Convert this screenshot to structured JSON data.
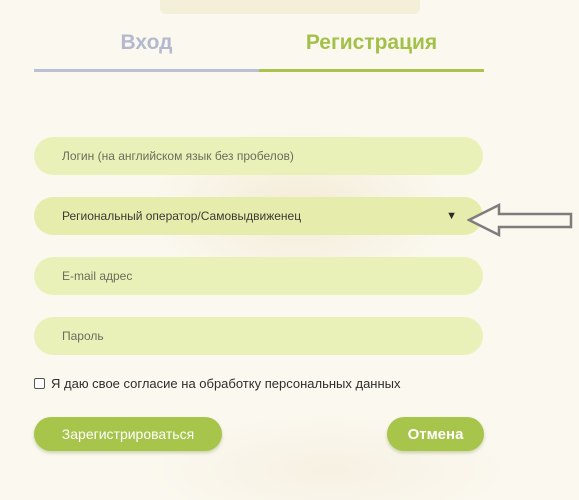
{
  "tabs": {
    "login_label": "Вход",
    "register_label": "Регистрация",
    "active": "register"
  },
  "form": {
    "login": {
      "placeholder": "Логин (на английском язык без пробелов)",
      "value": ""
    },
    "operator_select": {
      "selected": "Региональный оператор/Самовыдвиженец",
      "icon": "triangle-down-icon"
    },
    "email": {
      "placeholder": "E-mail адрес",
      "value": ""
    },
    "password": {
      "placeholder": "Пароль",
      "value": ""
    },
    "consent": {
      "label": "Я даю свое согласие на обработку персональных данных",
      "checked": false
    }
  },
  "buttons": {
    "register_label": "Зарегистрироваться",
    "cancel_label": "Отмена"
  },
  "annotation": {
    "icon": "left-arrow-outline-icon"
  },
  "colors": {
    "accent_green": "#a6c54a",
    "field_fill": "#eaf1b8",
    "inactive_tab": "#b5b9cf"
  }
}
